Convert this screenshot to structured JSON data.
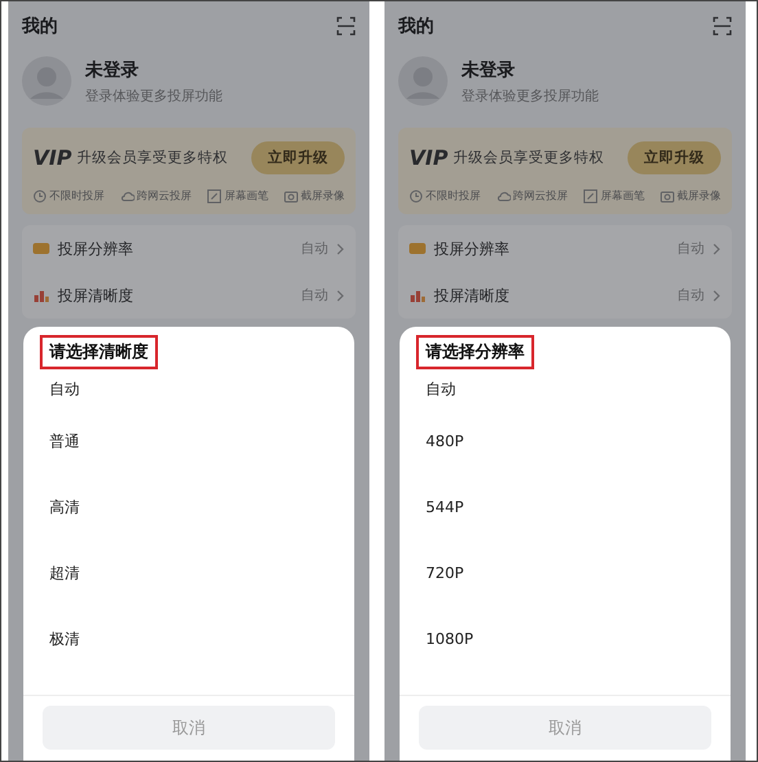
{
  "screens": [
    {
      "header": {
        "title": "我的"
      },
      "profile": {
        "name": "未登录",
        "subtitle": "登录体验更多投屏功能"
      },
      "vip": {
        "logo": "VIP",
        "text": "升级会员享受更多特权",
        "button": "立即升级",
        "features": [
          {
            "kind": "clock",
            "label": "不限时投屏"
          },
          {
            "kind": "cloud",
            "label": "跨网云投屏"
          },
          {
            "kind": "pen",
            "label": "屏幕画笔"
          },
          {
            "kind": "camera",
            "label": "截屏录像"
          }
        ]
      },
      "settings": [
        {
          "kind": "hd",
          "label": "投屏分辨率",
          "value": "自动"
        },
        {
          "kind": "clarity",
          "label": "投屏清晰度",
          "value": "自动"
        }
      ],
      "sheet": {
        "title": "请选择清晰度",
        "highlighted": true,
        "options": [
          "自动",
          "普通",
          "高清",
          "超清",
          "极清"
        ],
        "cancel": "取消"
      }
    },
    {
      "header": {
        "title": "我的"
      },
      "profile": {
        "name": "未登录",
        "subtitle": "登录体验更多投屏功能"
      },
      "vip": {
        "logo": "VIP",
        "text": "升级会员享受更多特权",
        "button": "立即升级",
        "features": [
          {
            "kind": "clock",
            "label": "不限时投屏"
          },
          {
            "kind": "cloud",
            "label": "跨网云投屏"
          },
          {
            "kind": "pen",
            "label": "屏幕画笔"
          },
          {
            "kind": "camera",
            "label": "截屏录像"
          }
        ]
      },
      "settings": [
        {
          "kind": "hd",
          "label": "投屏分辨率",
          "value": "自动"
        },
        {
          "kind": "clarity",
          "label": "投屏清晰度",
          "value": "自动"
        }
      ],
      "sheet": {
        "title": "请选择分辨率",
        "highlighted": true,
        "options": [
          "自动",
          "480P",
          "544P",
          "720P",
          "1080P"
        ],
        "cancel": "取消"
      }
    }
  ]
}
